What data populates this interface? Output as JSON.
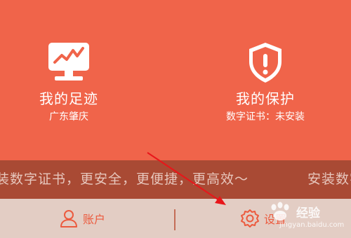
{
  "colors": {
    "background": "#f0644a",
    "banner": "#a94a34",
    "tabbar": "#e3cdc4",
    "accent": "#ec5a3e"
  },
  "cards": [
    {
      "icon": "monitor-chart-icon",
      "title": "我的足迹",
      "subtitle": "广东肇庆"
    },
    {
      "icon": "shield-alert-icon",
      "title": "我的保护",
      "subtitle": "数字证书：未安装"
    }
  ],
  "marquee": {
    "text_main": "装数字证书，更安全，更便捷，更高效～",
    "text_next": "安装数字"
  },
  "tabs": [
    {
      "icon": "user-icon",
      "label": "账户"
    },
    {
      "icon": "gear-icon",
      "label": "设置"
    }
  ],
  "watermark": {
    "text": "经验",
    "url": "jingyan.baidu.com"
  }
}
